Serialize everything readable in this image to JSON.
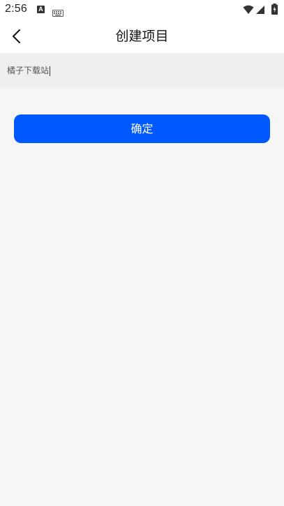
{
  "status_bar": {
    "time": "2:56",
    "icons": [
      "a-notification-icon",
      "keyboard-icon",
      "wifi-icon",
      "signal-icon",
      "battery-icon"
    ]
  },
  "header": {
    "title": "创建项目",
    "back_icon": "back-chevron-icon"
  },
  "form": {
    "project_name_value": "橘子下载站"
  },
  "actions": {
    "confirm_label": "确定"
  },
  "colors": {
    "primary": "#0059ff",
    "background": "#f6f6f6",
    "input_background": "#efefef"
  }
}
